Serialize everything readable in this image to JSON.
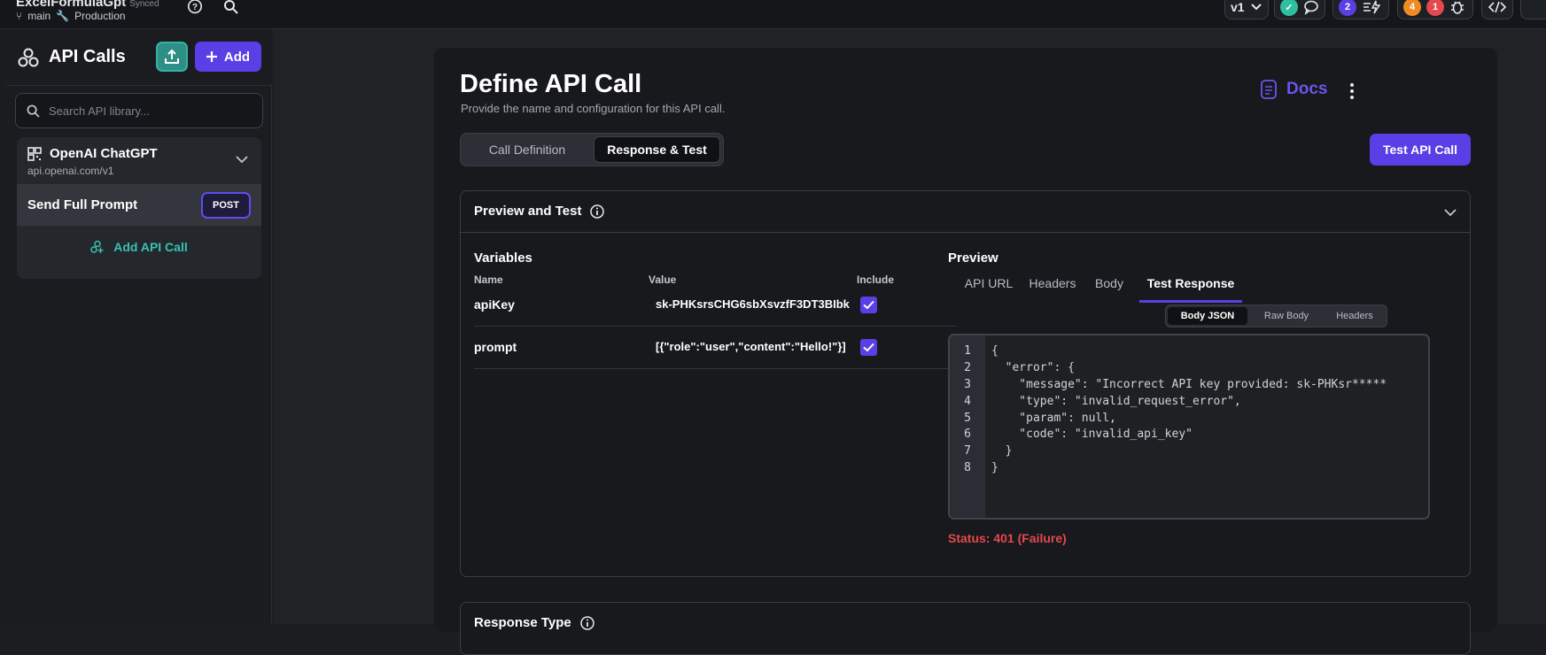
{
  "topbar": {
    "project_name": "ExcelFormulaGpt",
    "synced": "Synced",
    "branch": "main",
    "environment": "Production",
    "version": "v1",
    "badge_blue": "2",
    "badge_orange": "4",
    "badge_red": "1"
  },
  "sidebar": {
    "title": "API Calls",
    "add_label": "Add",
    "search_placeholder": "Search API library...",
    "group": {
      "name": "OpenAI ChatGPT",
      "url": "api.openai.com/v1"
    },
    "call": {
      "name": "Send Full Prompt",
      "method": "POST"
    },
    "add_call_label": "Add API Call"
  },
  "main": {
    "title": "Define API Call",
    "subtitle": "Provide the name and configuration for this API call.",
    "docs_label": "Docs",
    "tabs": [
      "Call Definition",
      "Response & Test"
    ],
    "test_button": "Test API Call",
    "section_title": "Preview and Test",
    "variables": {
      "title": "Variables",
      "columns": [
        "Name",
        "Value",
        "Include"
      ],
      "rows": [
        {
          "name": "apiKey",
          "value": "sk-PHKsrsCHG6sbXsvzfF3DT3BIbk",
          "include": true
        },
        {
          "name": "prompt",
          "value": "[{\"role\":\"user\",\"content\":\"Hello!\"}]",
          "include": true
        }
      ]
    },
    "preview": {
      "title": "Preview",
      "tabs": [
        "API URL",
        "Headers",
        "Body",
        "Test Response"
      ],
      "subtabs": [
        "Body JSON",
        "Raw Body",
        "Headers"
      ],
      "code_lines": [
        "{",
        "  \"error\": {",
        "    \"message\": \"Incorrect API key provided: sk-PHKsr*****",
        "    \"type\": \"invalid_request_error\",",
        "    \"param\": null,",
        "    \"code\": \"invalid_api_key\"",
        "  }",
        "}"
      ],
      "line_numbers": [
        "1",
        "2",
        "3",
        "4",
        "5",
        "6",
        "7",
        "8"
      ],
      "status_label": "Status:",
      "status_value": "401 (Failure)"
    },
    "section2_title": "Response Type"
  },
  "colors": {
    "accent": "#5b3fe6",
    "teal": "#39c2b2",
    "error": "#e5484d"
  }
}
